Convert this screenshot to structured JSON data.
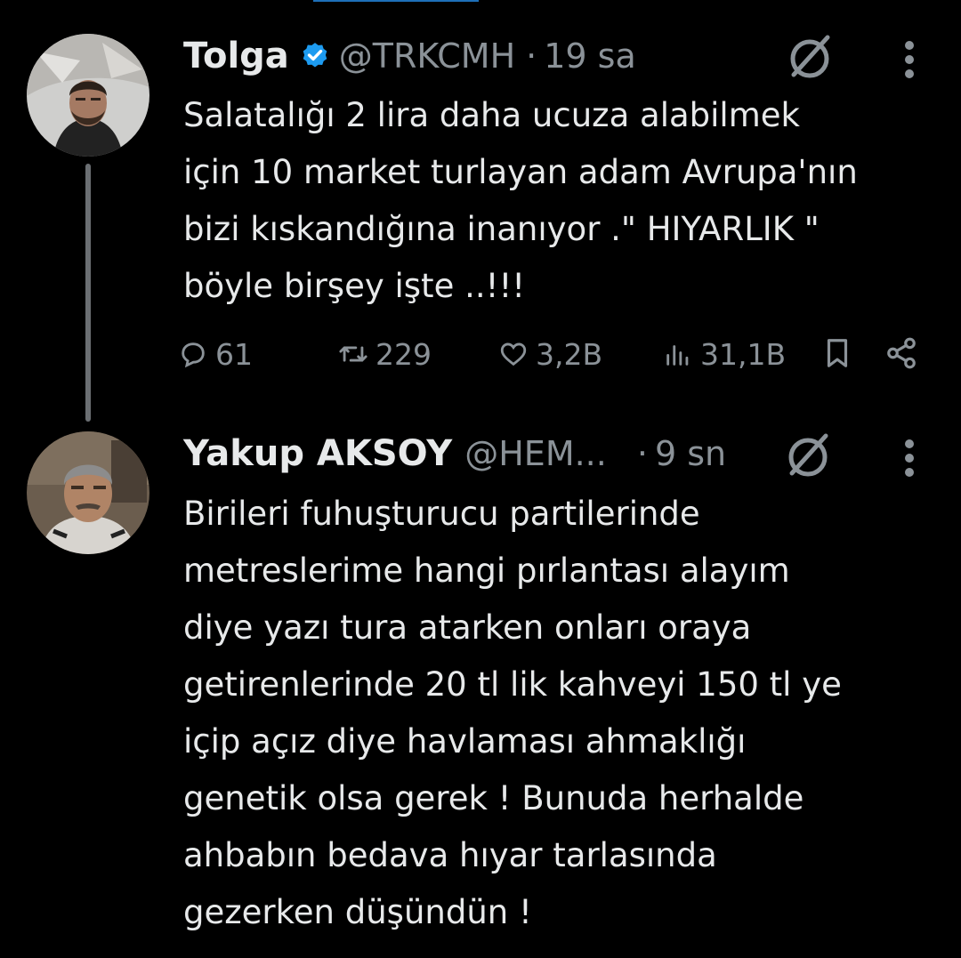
{
  "tweets": [
    {
      "author": {
        "name": "Tolga",
        "handle": "@TRKCMH",
        "verified": true
      },
      "separator": "·",
      "time": "19 sa",
      "lines": [
        "Salatalığı 2 lira daha ucuza alabilmek",
        "için 10 market turlayan adam Avrupa'nın",
        "bizi kıskandığına inanıyor .\" HIYARLIK \"",
        "böyle birşey işte ..!!!"
      ],
      "metrics": {
        "replies": "61",
        "reposts": "229",
        "likes": "3,2B",
        "views": "31,1B"
      }
    },
    {
      "author": {
        "name": "Yakup AKSOY",
        "handle": "@HEM...",
        "verified": false
      },
      "separator": "·",
      "time": "9 sn",
      "lines": [
        "Birileri fuhuşturucu partilerinde",
        "metreslerime hangi pırlantası alayım",
        "diye yazı tura atarken onları oraya",
        "getirenlerinde 20 tl lik kahveyi 150 tl ye",
        "içip açız diye havlaması ahmaklığı",
        "genetik olsa gerek ! Bunuda herhalde",
        "ahbabın bedava hıyar tarlasında",
        "gezerken düşündün !"
      ]
    }
  ],
  "icons": [
    "verified-badge-icon",
    "grok-icon",
    "more-icon",
    "reply-icon",
    "repost-icon",
    "like-icon",
    "views-icon",
    "bookmark-icon",
    "share-icon"
  ],
  "colors": {
    "background": "#000000",
    "text": "#e7e9ea",
    "secondary": "#8b9298",
    "verified": "#1d9bf0"
  }
}
